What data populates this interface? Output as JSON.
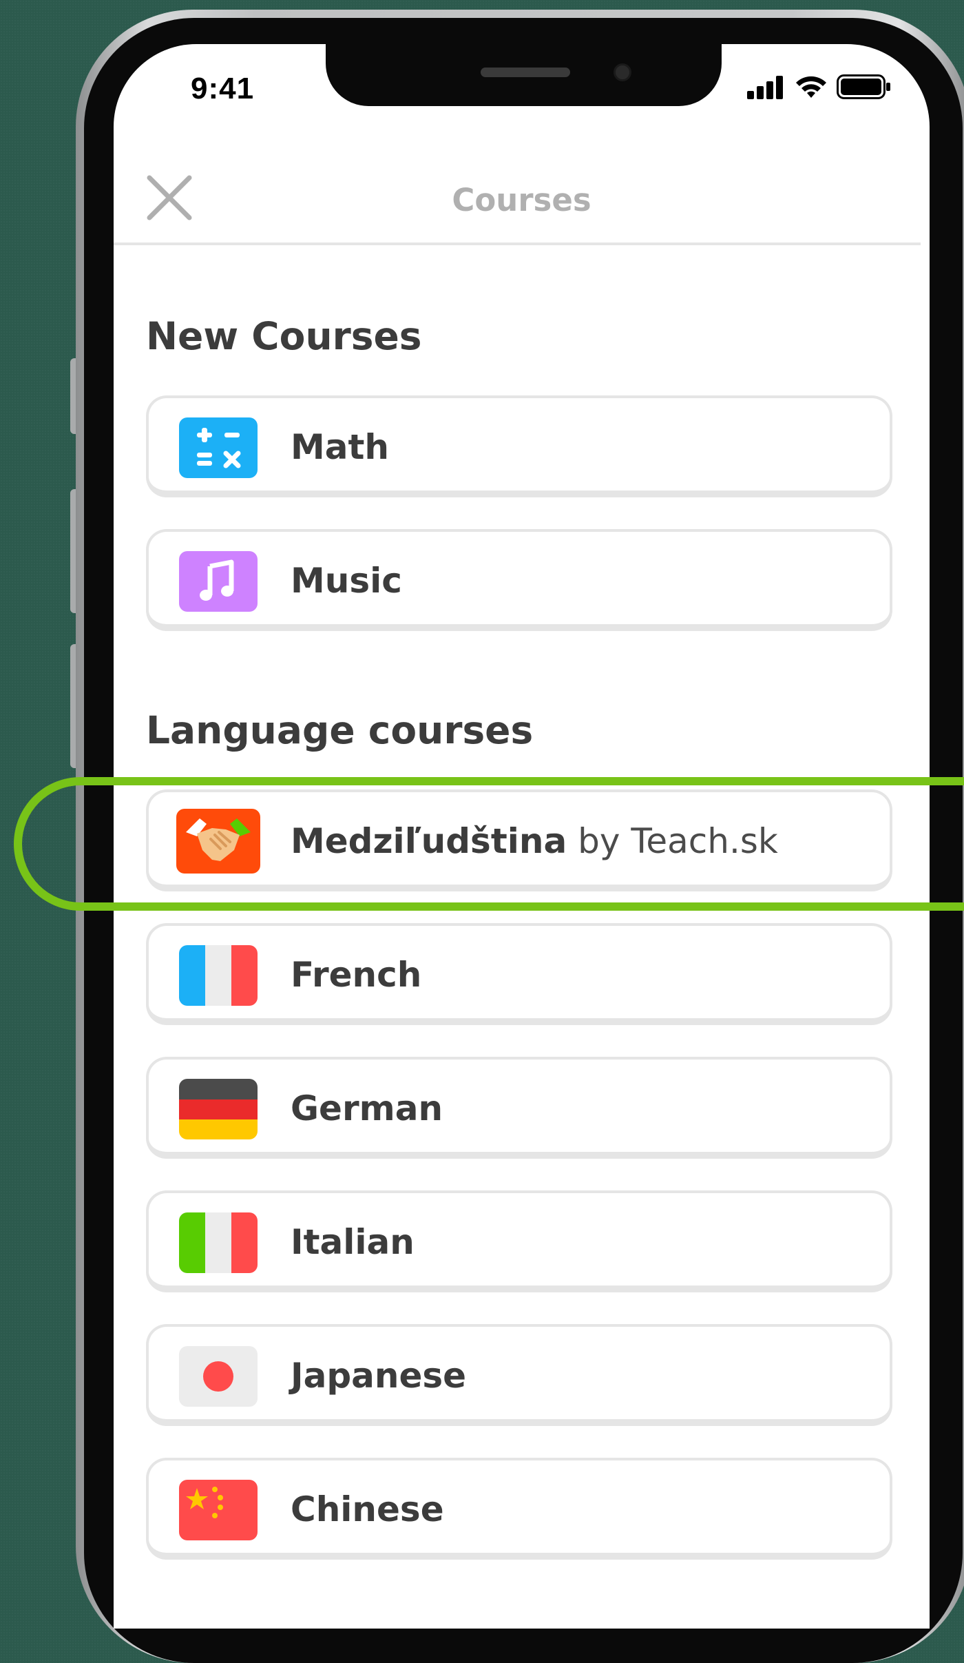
{
  "status_bar": {
    "time": "9:41"
  },
  "header": {
    "title": "Courses"
  },
  "sections": {
    "new": {
      "title": "New Courses",
      "courses": [
        {
          "label": "Math",
          "icon": "calculator-icon",
          "color": "#1cb0f6"
        },
        {
          "label": "Music",
          "icon": "music-note-icon",
          "color": "#ce82ff"
        }
      ]
    },
    "language": {
      "title": "Language courses",
      "featured": {
        "name": "Medziľudština",
        "by": " by Teach.sk",
        "icon": "handshake-icon",
        "color": "#ff4b0a"
      },
      "courses": [
        {
          "label": "French",
          "icon": "french-flag-icon"
        },
        {
          "label": "German",
          "icon": "german-flag-icon"
        },
        {
          "label": "Italian",
          "icon": "italian-flag-icon"
        },
        {
          "label": "Japanese",
          "icon": "japanese-flag-icon"
        },
        {
          "label": "Chinese",
          "icon": "chinese-flag-icon"
        }
      ]
    }
  },
  "accent_color": "#78c318"
}
